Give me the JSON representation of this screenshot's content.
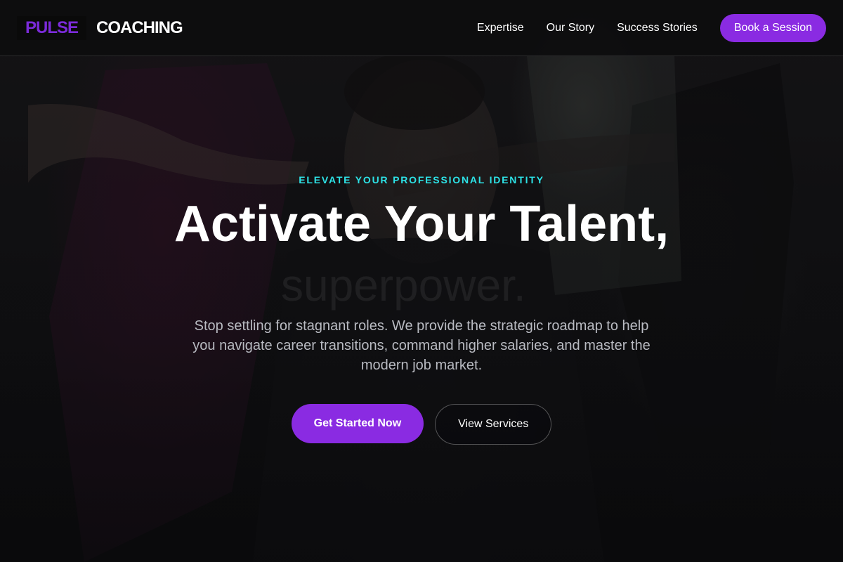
{
  "brand": {
    "mark": "PULSE",
    "name": "COACHING"
  },
  "nav": {
    "links": [
      {
        "label": "Expertise"
      },
      {
        "label": "Our Story"
      },
      {
        "label": "Success Stories"
      }
    ],
    "cta_label": "Book a Session"
  },
  "hero": {
    "eyebrow": "ELEVATE YOUR PROFESSIONAL IDENTITY",
    "headline": "Activate Your Talent,",
    "headline_secondary": "superpower.",
    "subtext": "Stop settling for stagnant roles. We provide the strategic roadmap to help you navigate career transitions, command higher salaries, and master the modern job market.",
    "primary_cta": "Get Started Now",
    "secondary_cta": "View Services"
  },
  "colors": {
    "accent": "#8a2be2",
    "eyebrow": "#2de2e6",
    "background": "#0c0c0e",
    "subtext": "#b9bbc2"
  }
}
